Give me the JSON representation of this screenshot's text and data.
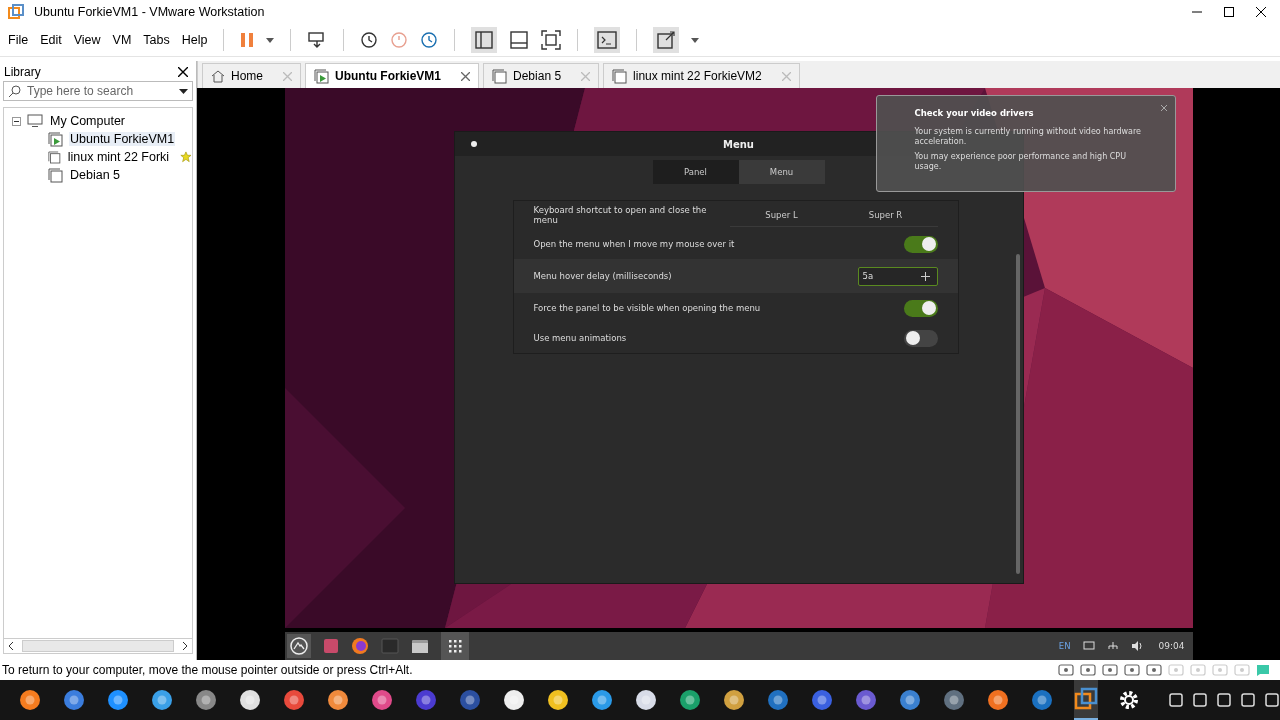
{
  "window": {
    "title": "Ubuntu ForkieVM1 - VMware Workstation"
  },
  "menu_bar": [
    "File",
    "Edit",
    "View",
    "VM",
    "Tabs",
    "Help"
  ],
  "library": {
    "title": "Library",
    "search": {
      "placeholder": "Type here to search"
    },
    "tree": [
      {
        "label": "My Computer",
        "expanded": true,
        "children": [
          {
            "label": "Ubuntu ForkieVM1",
            "selected": true,
            "running": true,
            "favorite": false
          },
          {
            "label": "linux mint 22 Forki",
            "selected": false,
            "running": false,
            "favorite": true
          },
          {
            "label": "Debian 5",
            "selected": false,
            "running": false,
            "favorite": false
          }
        ]
      }
    ]
  },
  "tabs": [
    {
      "label": "Home",
      "kind": "home",
      "selected": false
    },
    {
      "label": "Ubuntu ForkieVM1",
      "kind": "vm",
      "selected": true
    },
    {
      "label": "Debian 5",
      "kind": "vm",
      "selected": false
    },
    {
      "label": "linux mint 22 ForkieVM2",
      "kind": "vm",
      "selected": false
    }
  ],
  "guest": {
    "dialog": {
      "title": "Menu",
      "tabs": [
        {
          "label": "Panel",
          "selected": false
        },
        {
          "label": "Menu",
          "selected": true
        }
      ],
      "rows": [
        {
          "kind": "shortcut",
          "label": "Keyboard shortcut to open and close the menu",
          "highlighted": false,
          "keys": [
            "Super L",
            "Super R"
          ]
        },
        {
          "kind": "switch",
          "label": "Open the menu when I move my mouse over it",
          "highlighted": false,
          "on": true
        },
        {
          "kind": "spin",
          "label": "Menu hover delay (milliseconds)",
          "highlighted": true,
          "value": "5a"
        },
        {
          "kind": "switch",
          "label": "Force the panel to be visible when opening the menu",
          "highlighted": false,
          "on": true
        },
        {
          "kind": "switch",
          "label": "Use menu animations",
          "highlighted": false,
          "on": false
        }
      ]
    },
    "notification": {
      "title": "Check your video drivers",
      "paragraphs": [
        "Your system is currently running without video hardware acceleration.",
        "You may experience poor performance and high CPU usage."
      ]
    },
    "panel": {
      "language": "EN",
      "clock": "09:04"
    }
  },
  "status_bar": {
    "message": "To return to your computer, move the mouse pointer outside or press Ctrl+Alt."
  }
}
